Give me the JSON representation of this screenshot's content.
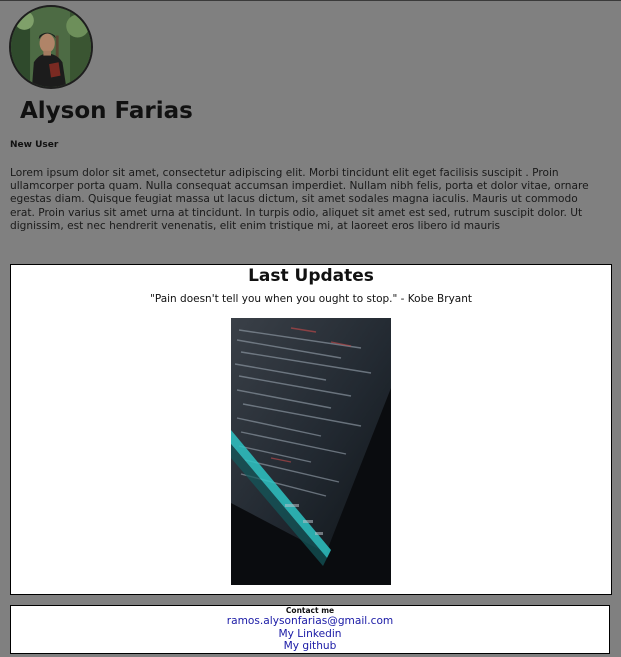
{
  "profile": {
    "name": "Alyson Farias",
    "role": "New User",
    "bio": "Lorem ipsum dolor sit amet, consectetur adipiscing elit. Morbi tincidunt elit eget facilisis suscipit . Proin ullamcorper porta quam. Nulla consequat accumsan imperdiet. Nullam nibh felis, porta et dolor vitae, ornare egestas diam. Quisque feugiat massa ut lacus dictum, sit amet sodales magna iaculis. Mauris ut commodo erat. Proin varius sit amet urna at tincidunt. In turpis odio, aliquet sit amet est sed, rutrum suscipit dolor. Ut dignissim, est nec hendrerit venenatis, elit enim tristique mi, at laoreet eros libero id mauris"
  },
  "updates": {
    "title": "Last Updates",
    "quote": "\"Pain doesn't tell you when you ought to stop.\" - Kobe Bryant"
  },
  "contact": {
    "title": "Contact me",
    "email": "ramos.alysonfarias@gmail.com",
    "linkedin": "My Linkedin",
    "github": "My github"
  },
  "colors": {
    "page_background": "#808080",
    "card_background": "#ffffff",
    "link": "#1a1aa6"
  }
}
